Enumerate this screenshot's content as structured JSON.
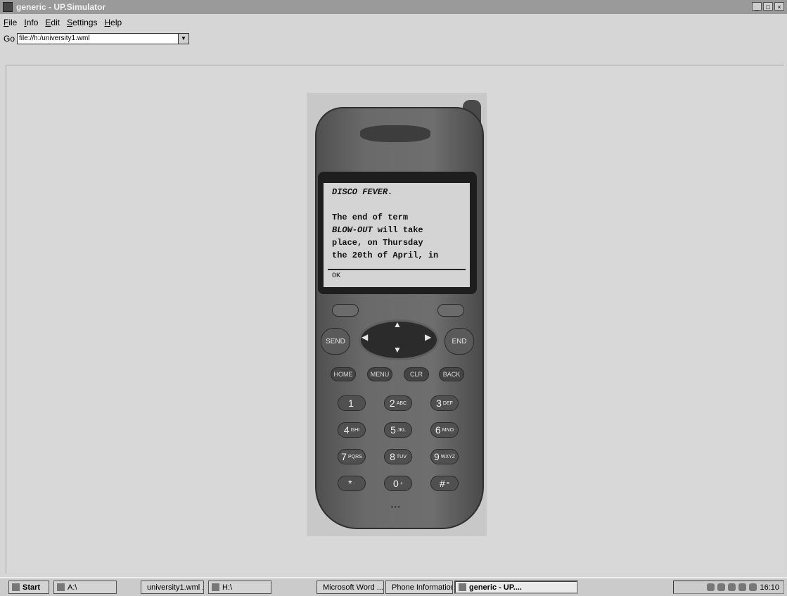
{
  "window": {
    "title": "generic - UP.Simulator",
    "controls": [
      "_",
      "□",
      "×"
    ]
  },
  "menubar": [
    {
      "accel": "F",
      "rest": "ile"
    },
    {
      "accel": "I",
      "rest": "nfo"
    },
    {
      "accel": "E",
      "rest": "dit"
    },
    {
      "accel": "S",
      "rest": "ettings"
    },
    {
      "accel": "H",
      "rest": "elp"
    }
  ],
  "gobar": {
    "label": "Go",
    "url": "file://h:/university1.wml",
    "dropdown_glyph": "▼"
  },
  "phone": {
    "screen_lines": [
      {
        "text": "DISCO FEVER.",
        "italic": true
      },
      {
        "text": ""
      },
      {
        "text": "The end of term"
      },
      {
        "text": "BLOW-OUT will take",
        "italic_part": "BLOW-OUT",
        "rest": " will take"
      },
      {
        "text": "place, on Thursday"
      },
      {
        "text": "the 20th of April, in"
      }
    ],
    "softkey": "OK",
    "send_label": "SEND",
    "end_label": "END",
    "function_keys": [
      "HOME",
      "MENU",
      "CLR",
      "BACK"
    ],
    "keypad": [
      {
        "digit": "1",
        "letters": ""
      },
      {
        "digit": "2",
        "letters": "ABC"
      },
      {
        "digit": "3",
        "letters": "DEF"
      },
      {
        "digit": "4",
        "letters": "GHI"
      },
      {
        "digit": "5",
        "letters": "JKL"
      },
      {
        "digit": "6",
        "letters": "MNO"
      },
      {
        "digit": "7",
        "letters": "PQRS"
      },
      {
        "digit": "8",
        "letters": "TUV"
      },
      {
        "digit": "9",
        "letters": "WXYZ"
      },
      {
        "digit": "*",
        "letters": "·"
      },
      {
        "digit": "0",
        "letters": "+"
      },
      {
        "digit": "#",
        "letters": "="
      }
    ],
    "nav_arrows": {
      "up": "▲",
      "down": "▼",
      "left": "◀",
      "right": "▶"
    }
  },
  "taskbar": {
    "start": "Start",
    "items": [
      "A:\\",
      "university1.wml ...",
      "H:\\",
      "Microsoft Word ...",
      "Phone Information",
      "generic - UP...."
    ],
    "active_item": "generic - UP....",
    "clock": "16:10"
  }
}
